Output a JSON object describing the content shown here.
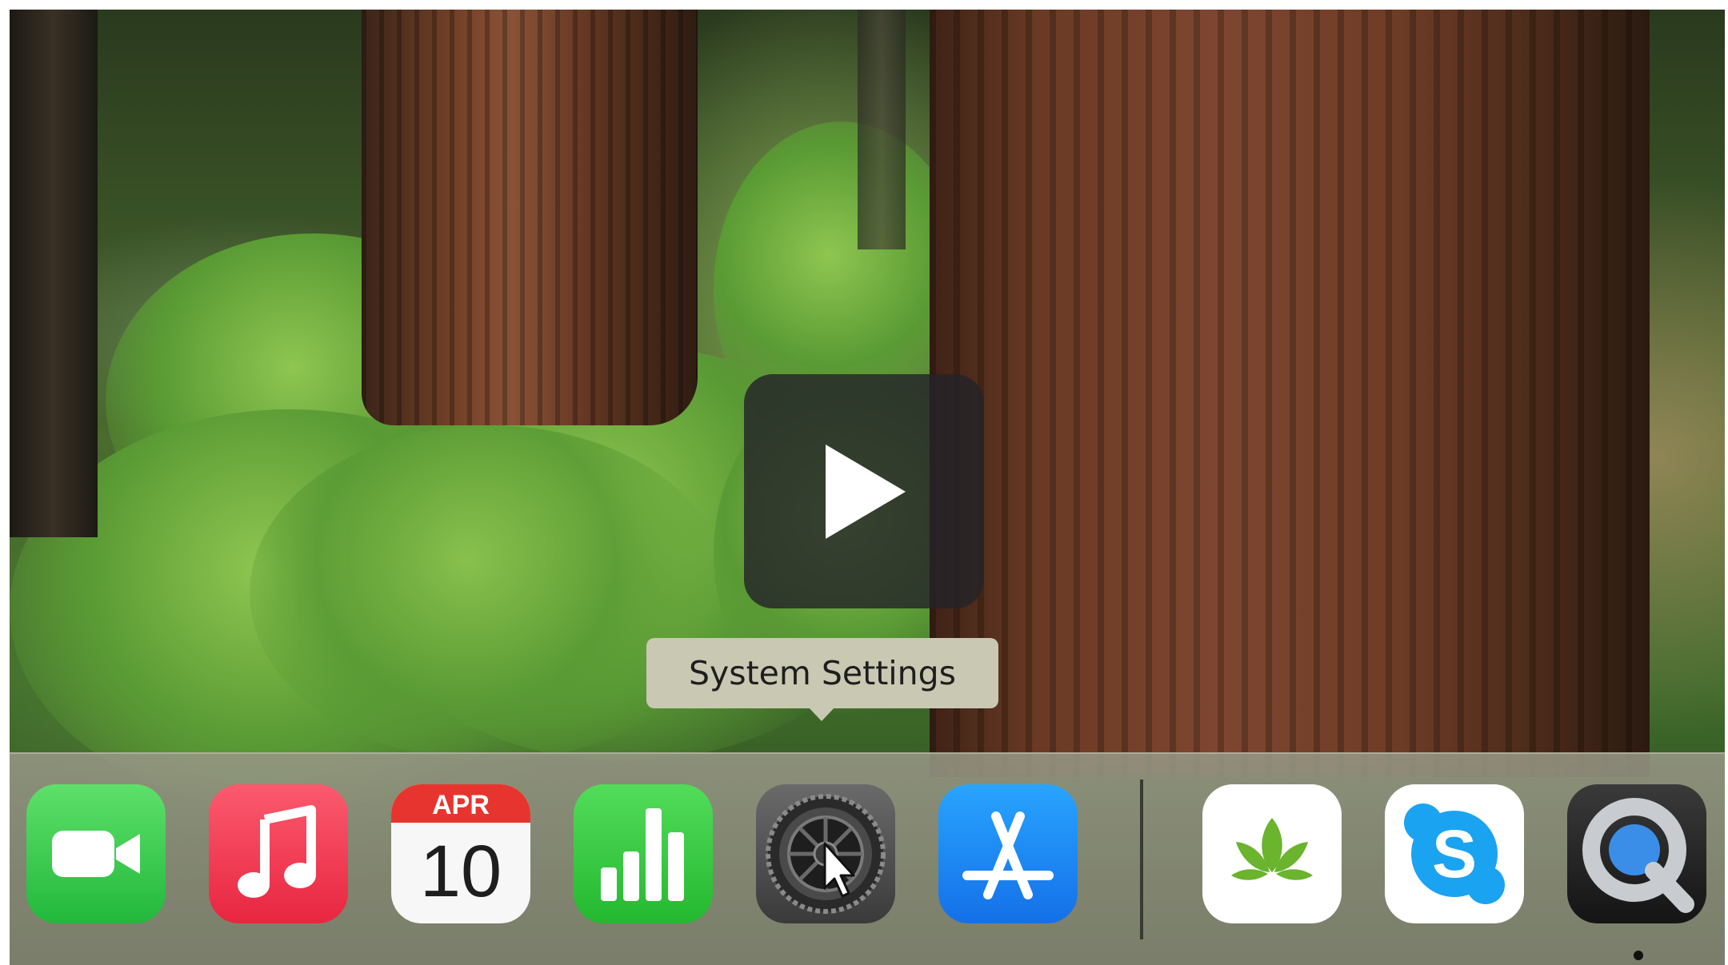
{
  "overlay": {
    "play_icon": "play-icon"
  },
  "tooltip": {
    "text": "System Settings"
  },
  "dock": {
    "apps": [
      {
        "name": "FaceTime",
        "icon": "facetime-icon"
      },
      {
        "name": "Music",
        "icon": "music-icon"
      },
      {
        "name": "Calendar",
        "icon": "calendar-icon",
        "month": "APR",
        "day": "10"
      },
      {
        "name": "Numbers",
        "icon": "numbers-icon"
      },
      {
        "name": "System Settings",
        "icon": "system-settings-icon",
        "hovered": true
      },
      {
        "name": "App Store",
        "icon": "app-store-icon"
      },
      {
        "name": "Leaf app",
        "icon": "leaf-icon"
      },
      {
        "name": "Skype",
        "icon": "skype-icon"
      },
      {
        "name": "QuickTime Player",
        "icon": "quicktime-icon",
        "running": true
      }
    ]
  },
  "colors": {
    "facetime_green": "#35c84a",
    "music_red": "#f0364c",
    "numbers_green": "#30c23c",
    "appstore_blue": "#1a8cf5",
    "skype_blue": "#1aa3f0",
    "tooltip_bg": "#c9c8b2"
  }
}
